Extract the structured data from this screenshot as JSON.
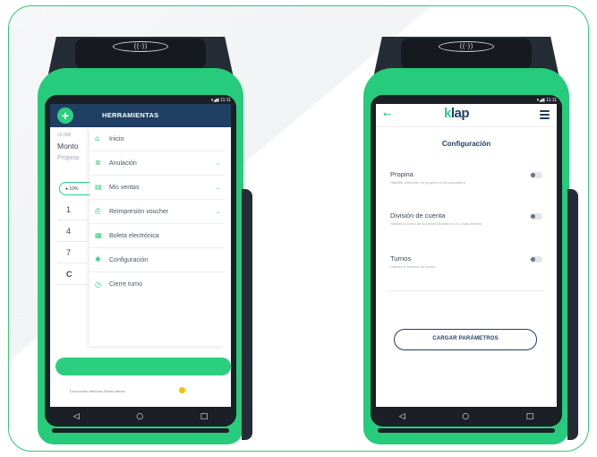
{
  "nfc_symbol": "((·))",
  "status_time": "▾◢▮ 11:11",
  "left_device": {
    "drawer_title": "HERRAMIENTAS",
    "behind": {
      "small_amount": "10.000",
      "monto": "Monto",
      "propina": "Propina",
      "chip": "● 10%",
      "keys": [
        "1",
        "4",
        "7",
        "C"
      ],
      "footer": "Documento tributario Boleta afecta"
    },
    "menu": [
      {
        "label": "Inicio",
        "icon": "home-icon",
        "glyph": "⌂",
        "chevron": false
      },
      {
        "label": "Anulación",
        "icon": "cancel-icon",
        "glyph": "⊗",
        "chevron": true
      },
      {
        "label": "Mis ventas",
        "icon": "receipt-icon",
        "glyph": "▤",
        "chevron": true
      },
      {
        "label": "Reimpresión voucher",
        "icon": "print-icon",
        "glyph": "⎙",
        "chevron": true
      },
      {
        "label": "Boleta electrónica",
        "icon": "document-icon",
        "glyph": "▦",
        "chevron": false
      },
      {
        "label": "Configuración",
        "icon": "gear-icon",
        "glyph": "✱",
        "chevron": false
      },
      {
        "label": "Cierre turno",
        "icon": "clock-icon",
        "glyph": "◷",
        "chevron": false
      }
    ]
  },
  "right_device": {
    "logo_k": "k",
    "logo_rest": "lap",
    "back": "←",
    "title": "Configuración",
    "settings": [
      {
        "label": "Propina",
        "desc": "Habilitar selección de propina en la calculadora",
        "enabled": false
      },
      {
        "label": "División de cuenta",
        "desc": "Habilita el cobro de la cuenta dividida en 2 o más clientes",
        "enabled": false
      },
      {
        "label": "Turnos",
        "desc": "Habilita el sistema de turnos",
        "enabled": false
      }
    ],
    "button": "CARGAR PARÁMETROS"
  },
  "nav": {
    "back": "◁",
    "home": "○",
    "recent": "□"
  },
  "colors": {
    "brand_green": "#26cc7b",
    "navy": "#1f3f63"
  }
}
